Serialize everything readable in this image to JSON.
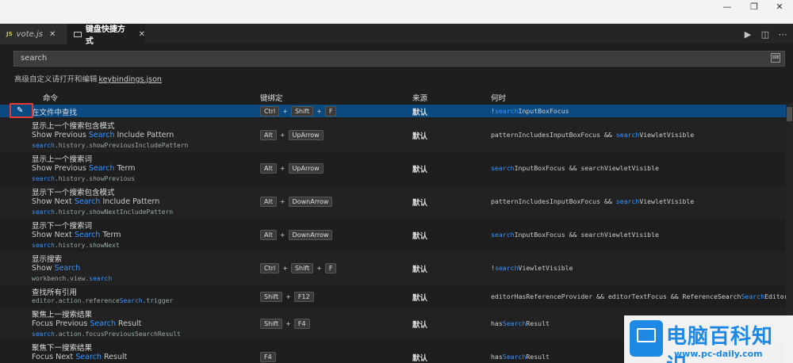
{
  "window": {
    "min": "—",
    "max": "❐",
    "close": "✕"
  },
  "tabs": [
    {
      "badge": "JS",
      "label": "vote.js",
      "close": "✕"
    },
    {
      "label": "键盘快捷方式",
      "close": "✕"
    }
  ],
  "toolbar": {
    "run_icon": "▶",
    "split_icon": "◫",
    "more_icon": "⋯"
  },
  "search": {
    "value": "search",
    "right_icon": "⌨"
  },
  "hint": {
    "text": "高级自定义请打开和编辑",
    "link": "keybindings.json"
  },
  "columns": {
    "command": "命令",
    "keybinding": "键绑定",
    "source": "来源",
    "when": "何时"
  },
  "rows": [
    {
      "title": "在文件中查找",
      "keys": [
        "Ctrl",
        "Shift",
        "F"
      ],
      "source": "默认",
      "when": {
        "a": "!",
        "b": "search",
        "c": "InputBoxFocus",
        "d": "",
        "e": ""
      }
    },
    {
      "title": "显示上一个搜索包含模式",
      "sub_a": "Show Previous ",
      "sub_b": "Search",
      "sub_c": " Include Pattern",
      "id_a": "search",
      "id_b": ".history.showPreviousIncludePattern",
      "id_c": "",
      "keys": [
        "Alt",
        "UpArrow"
      ],
      "source": "默认",
      "when": {
        "a": "patternIncludesInputBoxFocus && ",
        "b": "search",
        "c": "ViewletVisible",
        "d": "",
        "e": ""
      }
    },
    {
      "title": "显示上一个搜索词",
      "sub_a": "Show Previous ",
      "sub_b": "Search",
      "sub_c": " Term",
      "id_a": "search",
      "id_b": ".history.showPrevious",
      "id_c": "",
      "keys": [
        "Alt",
        "UpArrow"
      ],
      "source": "默认",
      "when": {
        "a": "",
        "b": "search",
        "c": "InputBoxFocus && searchViewletVisible",
        "d": "",
        "e": ""
      }
    },
    {
      "title": "显示下一个搜索包含模式",
      "sub_a": "Show Next ",
      "sub_b": "Search",
      "sub_c": " Include Pattern",
      "id_a": "search",
      "id_b": ".history.showNextIncludePattern",
      "id_c": "",
      "keys": [
        "Alt",
        "DownArrow"
      ],
      "source": "默认",
      "when": {
        "a": "patternIncludesInputBoxFocus && ",
        "b": "search",
        "c": "ViewletVisible",
        "d": "",
        "e": ""
      }
    },
    {
      "title": "显示下一个搜索词",
      "sub_a": "Show Next ",
      "sub_b": "Search",
      "sub_c": " Term",
      "id_a": "search",
      "id_b": ".history.showNext",
      "id_c": "",
      "keys": [
        "Alt",
        "DownArrow"
      ],
      "source": "默认",
      "when": {
        "a": "",
        "b": "search",
        "c": "InputBoxFocus && searchViewletVisible",
        "d": "",
        "e": ""
      }
    },
    {
      "title": "显示搜索",
      "sub_a": "Show ",
      "sub_b": "Search",
      "sub_c": "",
      "id_a": "workbench.view.",
      "id_b": "search",
      "id_c": "",
      "keys": [
        "Ctrl",
        "Shift",
        "F"
      ],
      "source": "默认",
      "when": {
        "a": "!",
        "b": "search",
        "c": "ViewletVisible",
        "d": "",
        "e": ""
      }
    },
    {
      "title": "查找所有引用",
      "sub_a": "",
      "sub_b": "",
      "sub_c": "",
      "id_a": "editor.action.reference",
      "id_b": "Search",
      "id_c": ".trigger",
      "keys": [
        "Shift",
        "F12"
      ],
      "source": "默认",
      "when": {
        "a": "editorHasReferenceProvider && editorTextFocus && ReferenceSearch",
        "b": "",
        "c": "",
        "d": "Search",
        "e": "Editor && !isInE…"
      }
    },
    {
      "title": "聚焦上一搜索结果",
      "sub_a": "Focus Previous ",
      "sub_b": "Search",
      "sub_c": " Result",
      "id_a": "search",
      "id_b": ".action.focusPreviousSearchResult",
      "id_c": "",
      "keys": [
        "Shift",
        "F4"
      ],
      "source": "默认",
      "when": {
        "a": "has",
        "b": "Search",
        "c": "Result",
        "d": "",
        "e": ""
      }
    },
    {
      "title": "聚焦下一搜索结果",
      "sub_a": "Focus Next ",
      "sub_b": "Search",
      "sub_c": " Result",
      "id_a": "",
      "id_b": "",
      "id_c": "",
      "keys": [
        "F4"
      ],
      "source": "默认",
      "when": {
        "a": "has",
        "b": "Search",
        "c": "Result",
        "d": "",
        "e": ""
      }
    }
  ],
  "edit_icon": "✎",
  "watermark": {
    "title": "电脑百科知识",
    "url": "www.pc-daily.com"
  }
}
